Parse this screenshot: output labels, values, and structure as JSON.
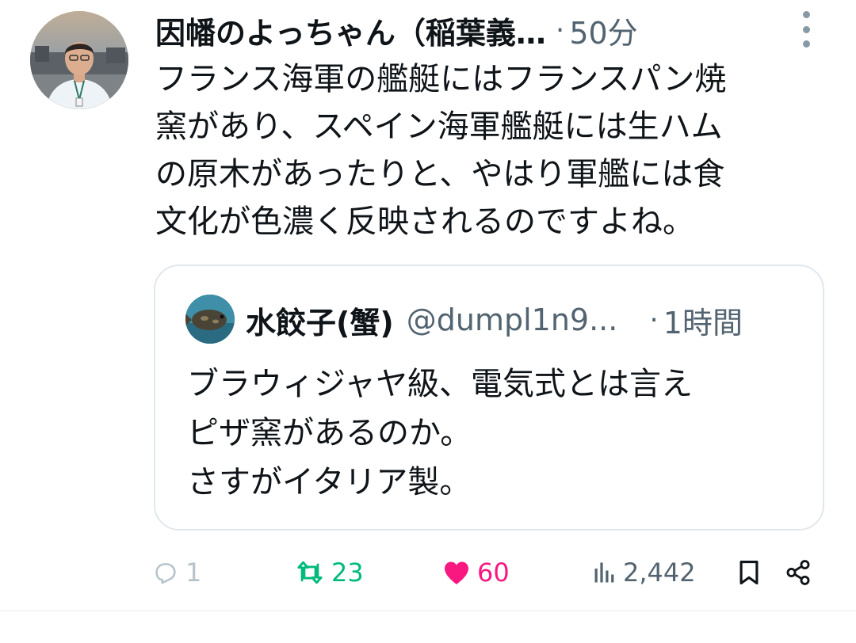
{
  "tweet": {
    "author_name": "因幡のよっちゃん（稲葉義…",
    "separator": "·",
    "time": "50分",
    "text": "フランス海軍の艦艇にはフランスパン焼\n窯があり、スペイン海軍艦艇には生ハム\nの原木があったりと、やはり軍艦には食\n文化が色濃く反映されるのですよね。"
  },
  "quote": {
    "author_name": "水餃子(蟹)",
    "handle": "@dumpl1n9...",
    "separator": "·",
    "time": "1時間",
    "text": "ブラウィジャヤ級、電気式とは言え\nピザ窯があるのか。\nさすがイタリア製。"
  },
  "actions": {
    "replies": "1",
    "retweets": "23",
    "likes": "60",
    "views": "2,442"
  },
  "icons": {
    "more": "more-vertical-icon",
    "reply": "reply-icon",
    "retweet": "retweet-icon",
    "like": "heart-icon",
    "views": "views-icon",
    "bookmark": "bookmark-icon",
    "share": "share-icon"
  },
  "colors": {
    "text": "#0f1419",
    "secondary": "#536471",
    "retweet": "#00ba7c",
    "like": "#f91880",
    "border": "#e1e8ed"
  }
}
